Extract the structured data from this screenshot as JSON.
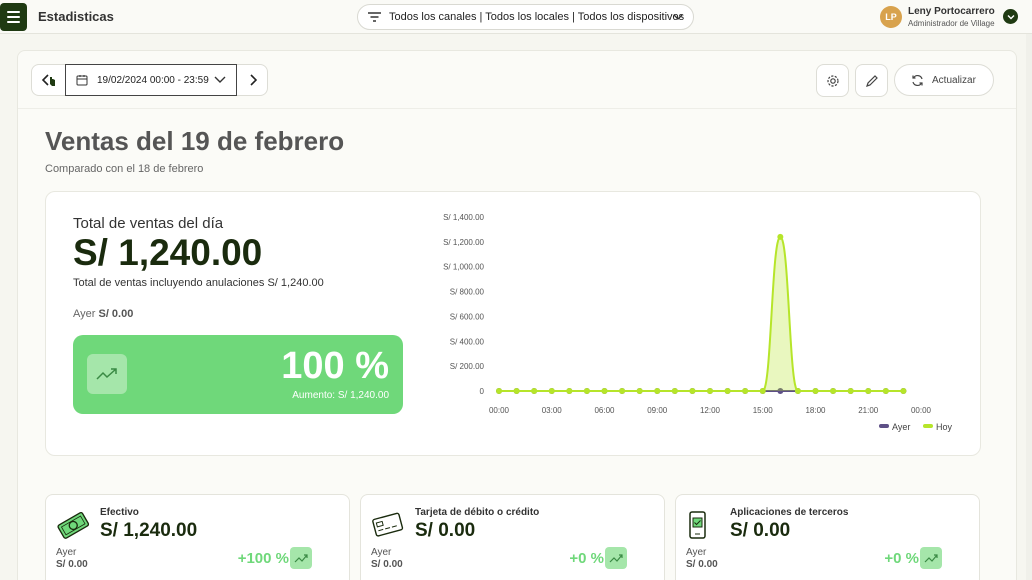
{
  "header": {
    "app_title": "Estadisticas",
    "filter_text": "Todos los canales | Todos los locales | Todos los dispositivos",
    "user": {
      "initials": "LP",
      "name": "Leny Portocarrero",
      "role": "Administrador de Village",
      "avatar_color": "#d8a24d"
    }
  },
  "toolbar": {
    "date_range": "19/02/2024 00:00 - 23:59",
    "refresh_label": "Actualizar"
  },
  "page": {
    "title": "Ventas del 19 de febrero",
    "subtitle": "Comparado con el 18 de febrero"
  },
  "summary": {
    "total_label": "Total de ventas del día",
    "total_value": "S/ 1,240.00",
    "total_sub": "Total de ventas incluyendo anulaciones S/ 1,240.00",
    "yesterday_label": "Ayer",
    "yesterday_value": "S/ 0.00",
    "pct_value": "100 %",
    "pct_sub": "Aumento: S/ 1,240.00",
    "accent_color": "#6fd87a"
  },
  "chart_data": {
    "type": "line",
    "y_tick_labels": [
      "S/ 1,400.00",
      "S/ 1,200.00",
      "S/ 1,000.00",
      "S/ 800.00",
      "S/ 600.00",
      "S/ 400.00",
      "S/ 200.00",
      "0"
    ],
    "y_ticks": [
      1400,
      1200,
      1000,
      800,
      600,
      400,
      200,
      0
    ],
    "ylim": [
      0,
      1400
    ],
    "x_tick_labels": [
      "00:00",
      "03:00",
      "06:00",
      "09:00",
      "12:00",
      "15:00",
      "18:00",
      "21:00",
      "00:00"
    ],
    "x_hours": [
      0,
      1,
      2,
      3,
      4,
      5,
      6,
      7,
      8,
      9,
      10,
      11,
      12,
      13,
      14,
      15,
      16,
      17,
      18,
      19,
      20,
      21,
      22,
      23
    ],
    "grid": false,
    "legend_position": "bottom-right",
    "series": [
      {
        "name": "Ayer",
        "color": "#5e5087",
        "values": [
          0,
          0,
          0,
          0,
          0,
          0,
          0,
          0,
          0,
          0,
          0,
          0,
          0,
          0,
          0,
          0,
          0,
          0,
          0,
          0,
          0,
          0,
          0,
          0
        ]
      },
      {
        "name": "Hoy",
        "color": "#b6e52a",
        "values": [
          0,
          0,
          0,
          0,
          0,
          0,
          0,
          0,
          0,
          0,
          0,
          0,
          0,
          0,
          0,
          0,
          1240,
          0,
          0,
          0,
          0,
          0,
          0,
          0
        ]
      }
    ]
  },
  "payments": [
    {
      "icon": "cash-icon",
      "label": "Efectivo",
      "value": "S/ 1,240.00",
      "yesterday_label": "Ayer",
      "yesterday_value": "S/ 0.00",
      "pct": "+100 %"
    },
    {
      "icon": "card-icon",
      "label": "Tarjeta de débito o crédito",
      "value": "S/ 0.00",
      "yesterday_label": "Ayer",
      "yesterday_value": "S/ 0.00",
      "pct": "+0 %"
    },
    {
      "icon": "phone-app-icon",
      "label": "Aplicaciones de terceros",
      "value": "S/ 0.00",
      "yesterday_label": "Ayer",
      "yesterday_value": "S/ 0.00",
      "pct": "+0 %"
    }
  ]
}
